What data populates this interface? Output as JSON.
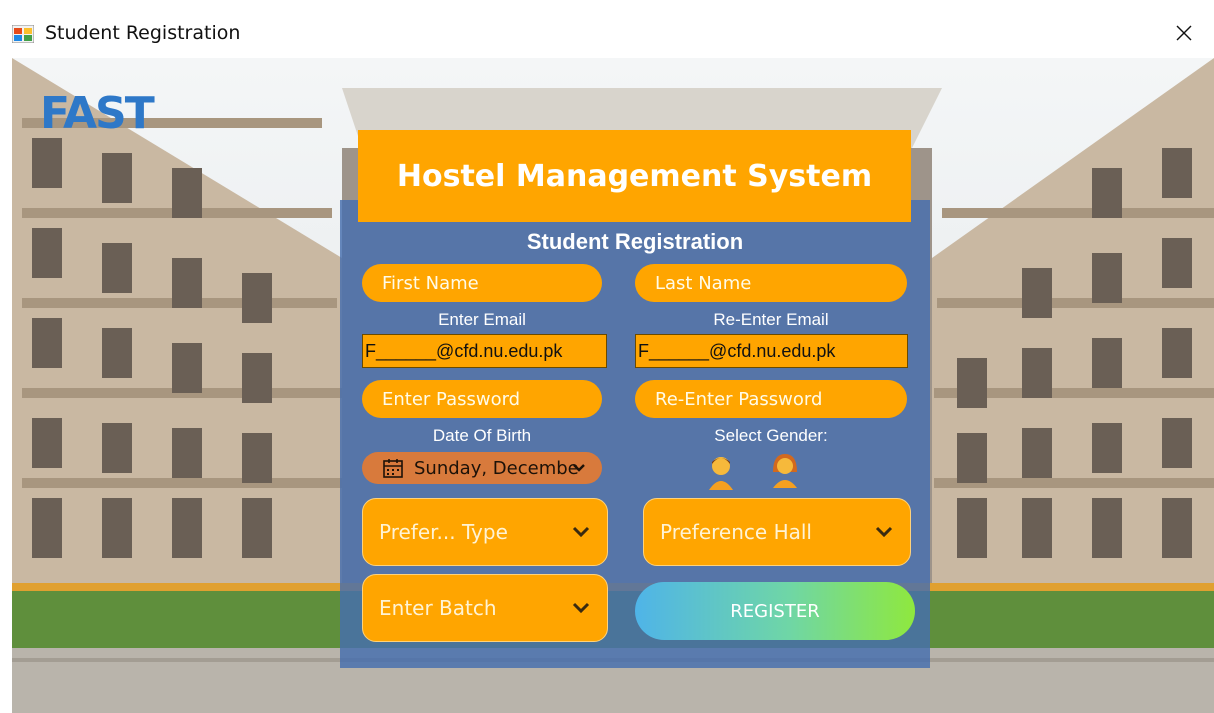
{
  "window": {
    "title": "Student Registration",
    "app_icon": "winforms-app-icon",
    "close_icon": "close-icon"
  },
  "logo": {
    "text": "FAST"
  },
  "header": {
    "title": "Hostel Management System",
    "subtitle": "Student Registration"
  },
  "form": {
    "first_name": {
      "value": "",
      "placeholder": "First Name"
    },
    "last_name": {
      "value": "",
      "placeholder": "Last Name"
    },
    "email_label": "Enter Email",
    "email_value": "F______@cfd.nu.edu.pk",
    "reemail_label": "Re-Enter Email",
    "reemail_value": "F______@cfd.nu.edu.pk",
    "password": {
      "value": "",
      "placeholder": "Enter Password"
    },
    "repassword": {
      "value": "",
      "placeholder": "Re-Enter Password"
    },
    "dob_label": "Date Of Birth",
    "dob_value": "Sunday, Decembe",
    "gender_label": "Select Gender:",
    "gender_options": [
      "male-avatar-icon",
      "female-avatar-icon"
    ],
    "preference_type": "Prefer... Type",
    "preference_hall": "Preference Hall",
    "batch": "Enter Batch",
    "register_label": "REGISTER"
  },
  "colors": {
    "accent": "#ffa500",
    "panel": "#466eaf",
    "date_bg": "#d87a3c",
    "register_gradient": [
      "#4fb4e8",
      "#8fe83e"
    ]
  }
}
